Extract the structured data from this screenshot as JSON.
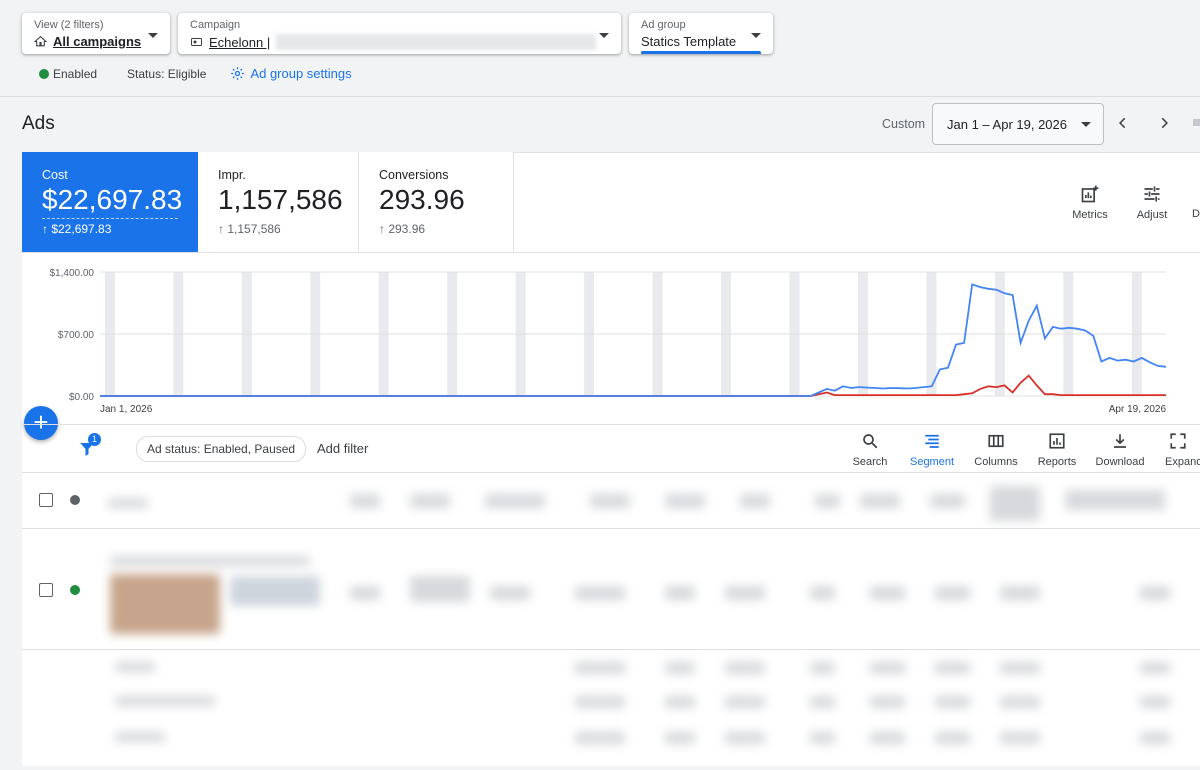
{
  "filters": {
    "view": {
      "label": "View (2 filters)",
      "value": "All campaigns"
    },
    "campaign": {
      "label": "Campaign",
      "value": "Echelonn |"
    },
    "adgroup": {
      "label": "Ad group",
      "value": "Statics Template"
    }
  },
  "status": {
    "enabled": "Enabled",
    "eligible": "Status: Eligible",
    "settings": "Ad group settings"
  },
  "page": {
    "title": "Ads",
    "date_mode": "Custom",
    "date_range": "Jan 1 – Apr 19, 2026"
  },
  "metrics": [
    {
      "label": "Cost",
      "value": "$22,697.83",
      "change": "↑ $22,697.83",
      "color": "#1a73e8"
    },
    {
      "label": "Impr.",
      "value": "1,157,586",
      "change": "↑ 1,157,586",
      "color": "#ffffff"
    },
    {
      "label": "Conversions",
      "value": "293.96",
      "change": "↑ 293.96",
      "color": "#ffffff"
    }
  ],
  "metric_actions": [
    {
      "label": "Metrics",
      "icon": "add-chart-icon"
    },
    {
      "label": "Adjust",
      "icon": "tune-icon"
    }
  ],
  "chart_data": {
    "type": "line",
    "y_ticks": [
      "$1,400.00",
      "$700.00",
      "$0.00"
    ],
    "ylim": [
      0,
      1400
    ],
    "x_start_label": "Jan 1, 2026",
    "x_end_label": "Apr 19, 2026",
    "grid": false,
    "series": [
      {
        "color": "#4285f4",
        "values": [
          0,
          0,
          0,
          0,
          0,
          0,
          0,
          0,
          0,
          0,
          0,
          0,
          0,
          0,
          0,
          0,
          0,
          0,
          0,
          0,
          0,
          0,
          0,
          0,
          0,
          0,
          0,
          0,
          0,
          0,
          0,
          0,
          0,
          0,
          0,
          0,
          0,
          0,
          0,
          0,
          0,
          0,
          0,
          0,
          0,
          0,
          0,
          0,
          0,
          0,
          0,
          0,
          0,
          0,
          0,
          0,
          0,
          0,
          0,
          0,
          0,
          0,
          0,
          0,
          0,
          0,
          0,
          0,
          0,
          0,
          0,
          0,
          0,
          0,
          0,
          0,
          0,
          0,
          0,
          0,
          0,
          0,
          0,
          0,
          0,
          0,
          0,
          0,
          0,
          0,
          0,
          0,
          0,
          0,
          0,
          0,
          0,
          0,
          0,
          0,
          0,
          0,
          0,
          0,
          0,
          0,
          0,
          0,
          0,
          0,
          0,
          0,
          0,
          0,
          0,
          0,
          0,
          0,
          0,
          0,
          0,
          0,
          0,
          0,
          0,
          0,
          0,
          0,
          0,
          0,
          0,
          0,
          0,
          0,
          0,
          0,
          0,
          0,
          0,
          0,
          0,
          0,
          0,
          0,
          0,
          0,
          0,
          0,
          0,
          0,
          0,
          0,
          0,
          0,
          0,
          0,
          0,
          0,
          0,
          0,
          0,
          0,
          0,
          0,
          0,
          0,
          0,
          0,
          0,
          0,
          0,
          0,
          0,
          0,
          0,
          0,
          0,
          0,
          0,
          0,
          0,
          0,
          0,
          0,
          0,
          0,
          0,
          0,
          0,
          0,
          0,
          0,
          0,
          0,
          0,
          0,
          0,
          0,
          0,
          0,
          0,
          0,
          0,
          0,
          0,
          0,
          0,
          0,
          0,
          0
        ]
      },
      {
        "color": "#d93025",
        "values": []
      }
    ],
    "blue_points": [
      [
        0,
        0
      ],
      [
        88,
        0
      ],
      [
        89,
        40
      ],
      [
        90,
        80
      ],
      [
        91,
        60
      ],
      [
        92,
        110
      ],
      [
        93,
        90
      ],
      [
        94,
        100
      ],
      [
        95,
        95
      ],
      [
        96,
        90
      ],
      [
        97,
        85
      ],
      [
        98,
        90
      ],
      [
        99,
        88
      ],
      [
        100,
        85
      ],
      [
        101,
        90
      ],
      [
        102,
        100
      ],
      [
        103,
        110
      ],
      [
        104,
        300
      ],
      [
        105,
        320
      ],
      [
        106,
        580
      ],
      [
        107,
        600
      ],
      [
        108,
        1260
      ],
      [
        109,
        1230
      ],
      [
        110,
        1210
      ],
      [
        111,
        1200
      ],
      [
        112,
        1160
      ],
      [
        113,
        1140
      ],
      [
        114,
        600
      ],
      [
        115,
        850
      ],
      [
        116,
        1020
      ],
      [
        117,
        650
      ],
      [
        118,
        780
      ],
      [
        119,
        760
      ],
      [
        120,
        770
      ],
      [
        121,
        760
      ],
      [
        122,
        740
      ],
      [
        123,
        680
      ],
      [
        124,
        390
      ],
      [
        125,
        430
      ],
      [
        126,
        400
      ],
      [
        127,
        410
      ],
      [
        128,
        390
      ],
      [
        129,
        430
      ],
      [
        130,
        380
      ],
      [
        131,
        340
      ],
      [
        132,
        330
      ]
    ],
    "red_points": [
      [
        0,
        0
      ],
      [
        88,
        0
      ],
      [
        89,
        20
      ],
      [
        90,
        40
      ],
      [
        91,
        10
      ],
      [
        92,
        10
      ],
      [
        93,
        10
      ],
      [
        94,
        10
      ],
      [
        95,
        10
      ],
      [
        96,
        10
      ],
      [
        97,
        10
      ],
      [
        98,
        10
      ],
      [
        99,
        10
      ],
      [
        100,
        10
      ],
      [
        101,
        10
      ],
      [
        102,
        10
      ],
      [
        103,
        10
      ],
      [
        104,
        10
      ],
      [
        105,
        10
      ],
      [
        106,
        10
      ],
      [
        107,
        20
      ],
      [
        108,
        30
      ],
      [
        109,
        80
      ],
      [
        110,
        110
      ],
      [
        111,
        100
      ],
      [
        112,
        120
      ],
      [
        113,
        40
      ],
      [
        114,
        150
      ],
      [
        115,
        230
      ],
      [
        116,
        120
      ],
      [
        117,
        20
      ],
      [
        118,
        20
      ],
      [
        119,
        10
      ],
      [
        120,
        10
      ],
      [
        121,
        10
      ],
      [
        122,
        10
      ],
      [
        123,
        10
      ],
      [
        124,
        10
      ],
      [
        125,
        10
      ],
      [
        126,
        10
      ],
      [
        127,
        10
      ],
      [
        128,
        10
      ],
      [
        129,
        10
      ],
      [
        130,
        10
      ],
      [
        131,
        10
      ],
      [
        132,
        10
      ]
    ]
  },
  "toolbar": {
    "ad_status_filter": "Ad status: Enabled, Paused",
    "add_filter": "Add filter",
    "filter_badge": "1",
    "actions": [
      {
        "label": "Search",
        "icon": "search-icon"
      },
      {
        "label": "Segment",
        "icon": "segment-icon",
        "active": true
      },
      {
        "label": "Columns",
        "icon": "columns-icon"
      },
      {
        "label": "Reports",
        "icon": "reports-icon"
      },
      {
        "label": "Download",
        "icon": "download-icon"
      },
      {
        "label": "Expand",
        "icon": "expand-icon"
      }
    ]
  }
}
